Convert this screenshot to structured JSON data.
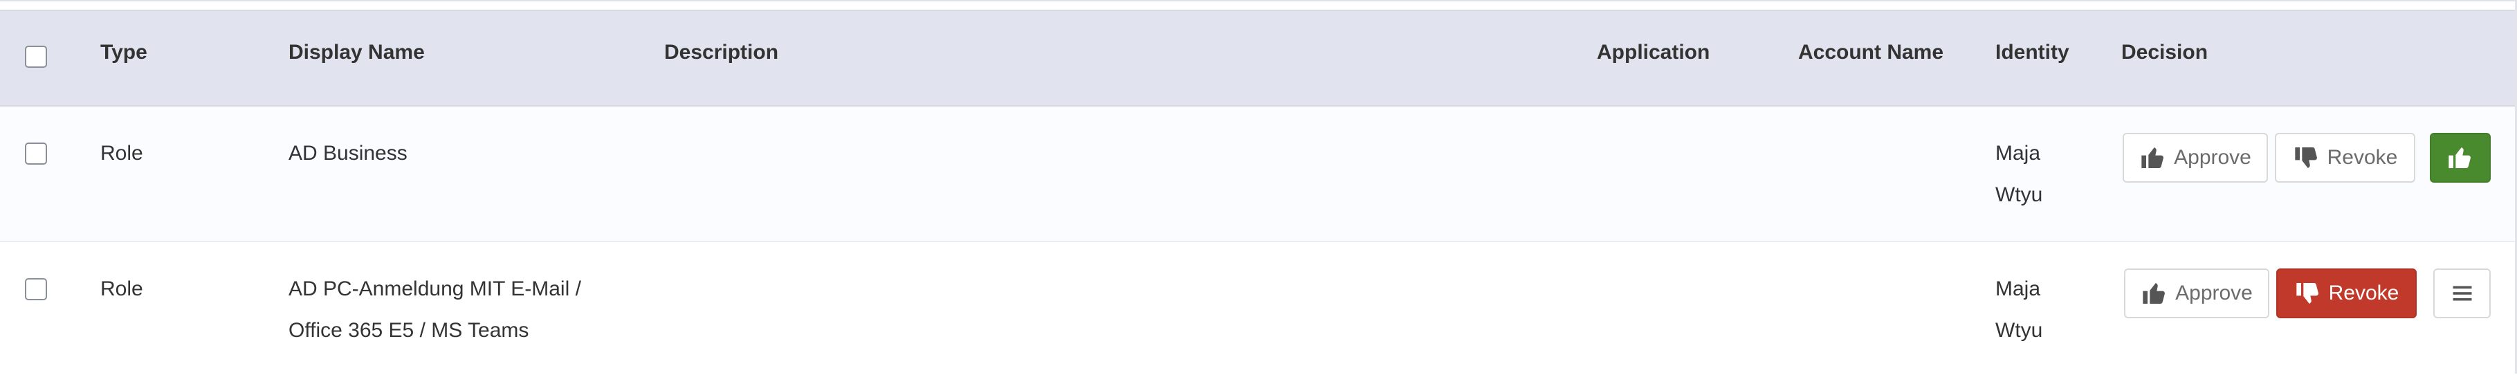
{
  "table": {
    "columns": {
      "type": "Type",
      "display_name": "Display Name",
      "description": "Description",
      "application": "Application",
      "account_name": "Account Name",
      "identity": "Identity",
      "decision": "Decision"
    },
    "rows": [
      {
        "type": "Role",
        "display_name_line1": "AD Business",
        "display_name_line2": "",
        "description": "",
        "application": "",
        "account_name": "",
        "identity_line1": "Maja",
        "identity_line2": "Wtyu",
        "approve_label": "Approve",
        "revoke_label": "Revoke",
        "decision_state": "approved"
      },
      {
        "type": "Role",
        "display_name_line1": "AD PC-Anmeldung MIT E-Mail /",
        "display_name_line2": "Office 365 E5 / MS Teams",
        "description": "",
        "application": "",
        "account_name": "",
        "identity_line1": "Maja",
        "identity_line2": "Wtyu",
        "approve_label": "Approve",
        "revoke_label": "Revoke",
        "decision_state": "revoked"
      }
    ]
  },
  "icons": {
    "thumbs_up": "thumbs-up-icon",
    "thumbs_down": "thumbs-down-icon",
    "menu": "hamburger-menu-icon"
  },
  "colors": {
    "header_bg": "#e1e3ee",
    "approve_active": "#4a8a2e",
    "revoke_active": "#c0392b"
  }
}
